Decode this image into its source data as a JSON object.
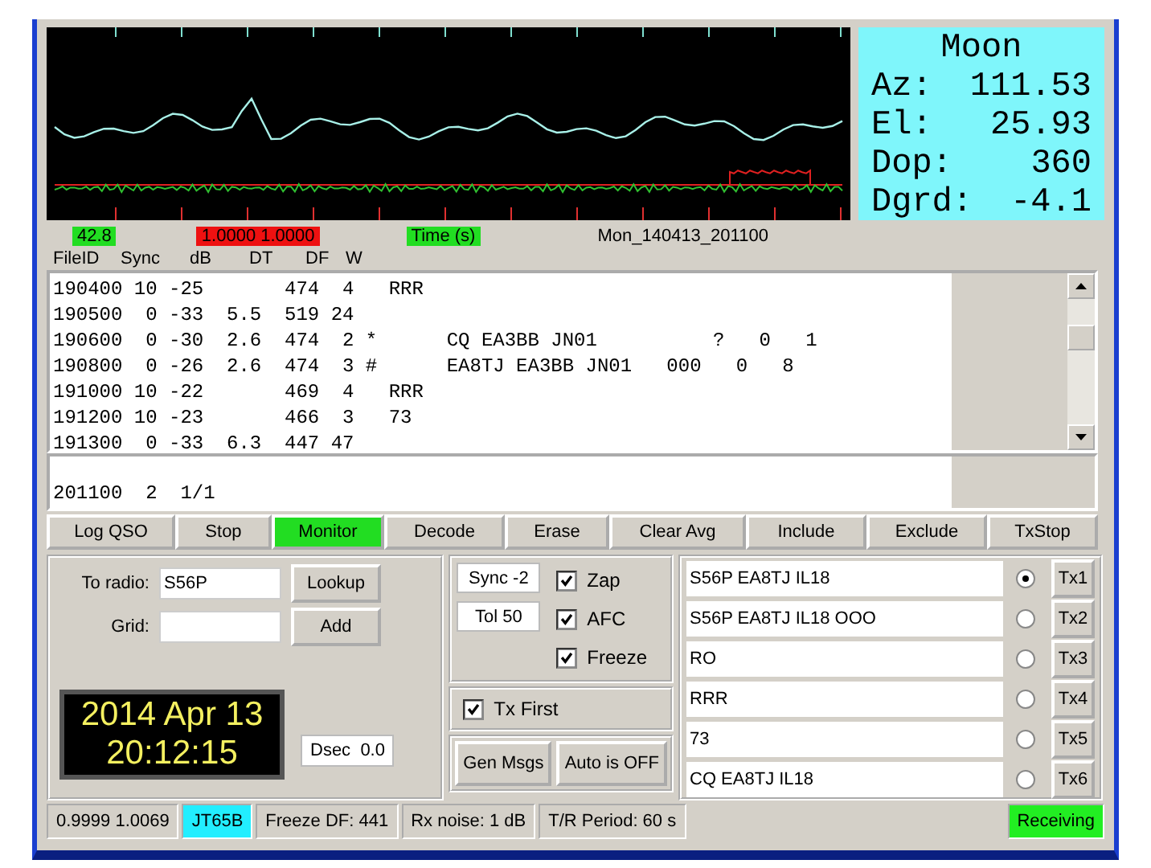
{
  "plot": {
    "readouts": [
      {
        "text": "42.8",
        "color": "#22dd22"
      },
      {
        "text": "1.0000  1.0000",
        "color": "#ee1111"
      },
      {
        "text": "Time (s)",
        "color": "#22dd22"
      },
      {
        "text": "Mon_140413_201100"
      }
    ]
  },
  "moon": {
    "title": "Moon",
    "rows": [
      {
        "label": "Az:",
        "value": "111.53"
      },
      {
        "label": "El:",
        "value": "25.93"
      },
      {
        "label": "Dop:",
        "value": "360"
      },
      {
        "label": "Dgrd:",
        "value": "-4.1"
      }
    ]
  },
  "decode": {
    "columns": [
      "FileID",
      "Sync",
      "dB",
      "DT",
      "DF",
      "W"
    ],
    "lines": [
      "190400 10 -25       474  4   RRR",
      "190500  0 -33  5.5  519 24",
      "190600  0 -30  2.6  474  2 *      CQ EA3BB JN01          ?   0   1",
      "190800  0 -26  2.6  474  3 #      EA8TJ EA3BB JN01   000   0   8",
      "191000 10 -22       469  4   RRR",
      "191200 10 -23       466  3   73",
      "191300  0 -33  6.3  447 47"
    ]
  },
  "average": {
    "lines": [
      "201100  2  1/1"
    ]
  },
  "buttons": [
    {
      "label": "Log QSO",
      "active": false
    },
    {
      "label": "Stop",
      "active": false
    },
    {
      "label": "Monitor",
      "active": true
    },
    {
      "label": "Decode",
      "active": false
    },
    {
      "label": "Erase",
      "active": false
    },
    {
      "label": "Clear Avg",
      "active": false
    },
    {
      "label": "Include",
      "active": false
    },
    {
      "label": "Exclude",
      "active": false
    },
    {
      "label": "TxStop",
      "active": false
    }
  ],
  "station": {
    "to_radio_label": "To radio:",
    "to_radio": "S56P",
    "lookup": "Lookup",
    "grid_label": "Grid:",
    "add": "Add"
  },
  "clock": {
    "date": "2014 Apr 13",
    "time": "20:12:15"
  },
  "dsec": {
    "label": "Dsec",
    "value": "0.0"
  },
  "decoder": {
    "sync": {
      "label": "Sync",
      "value": "-2"
    },
    "tol": {
      "label": "Tol",
      "value": "50"
    },
    "options": [
      {
        "label": "Zap",
        "checked": true
      },
      {
        "label": "AFC",
        "checked": true
      },
      {
        "label": "Freeze",
        "checked": true
      }
    ],
    "tx_first": {
      "label": "Tx First",
      "checked": true
    },
    "buttons": [
      "Gen Msgs",
      "Auto is OFF"
    ]
  },
  "messages": [
    {
      "text": "S56P EA8TJ IL18",
      "selected": true,
      "button": "Tx1"
    },
    {
      "text": "S56P EA8TJ IL18 OOO",
      "selected": false,
      "button": "Tx2"
    },
    {
      "text": "RO",
      "selected": false,
      "button": "Tx3"
    },
    {
      "text": "RRR",
      "selected": false,
      "button": "Tx4"
    },
    {
      "text": "73",
      "selected": false,
      "button": "Tx5"
    },
    {
      "text": "CQ EA8TJ IL18",
      "selected": false,
      "button": "Tx6"
    }
  ],
  "status_bar": {
    "cells": [
      {
        "text": "0.9999 1.0069"
      },
      {
        "text": "JT65B",
        "color": "#22eeff"
      },
      {
        "text": "Freeze DF: 441"
      },
      {
        "text": "Rx noise:  1 dB"
      },
      {
        "text": "T/R Period: 60 s"
      }
    ],
    "state": {
      "text": "Receiving",
      "color": "#22ee22"
    }
  }
}
